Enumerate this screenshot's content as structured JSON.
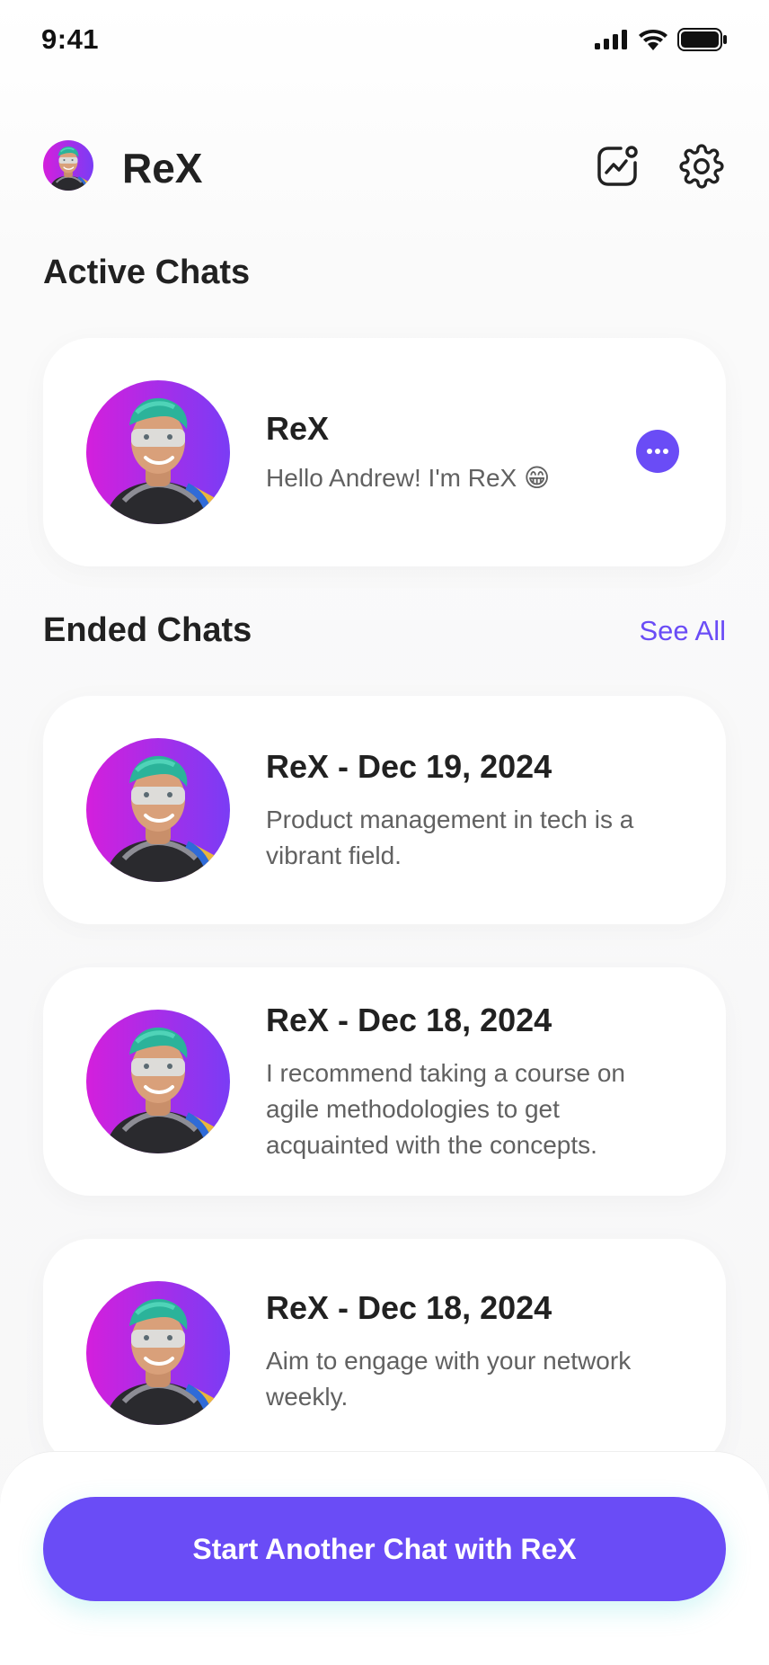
{
  "status_bar": {
    "time": "9:41"
  },
  "header": {
    "title": "ReX",
    "stats_icon": "chart-icon",
    "settings_icon": "gear-icon"
  },
  "active_section": {
    "title": "Active Chats"
  },
  "active_chat": {
    "title": "ReX",
    "message": "Hello Andrew! I'm ReX 😁",
    "action_icon": "chat-bubble-icon"
  },
  "ended_section": {
    "title": "Ended Chats",
    "see_all": "See All"
  },
  "ended_chats": [
    {
      "title": "ReX - Dec 19, 2024",
      "message": "Product management in tech is a vibrant field."
    },
    {
      "title": "ReX - Dec 18, 2024",
      "message": "I recommend taking a course on agile methodologies to get acquainted with the concepts."
    },
    {
      "title": "ReX - Dec 18, 2024",
      "message": "Aim to engage with your network weekly."
    }
  ],
  "cta": {
    "label": "Start Another Chat with ReX"
  },
  "colors": {
    "accent": "#6a4cf6",
    "text": "#212121",
    "muted": "#616161"
  }
}
